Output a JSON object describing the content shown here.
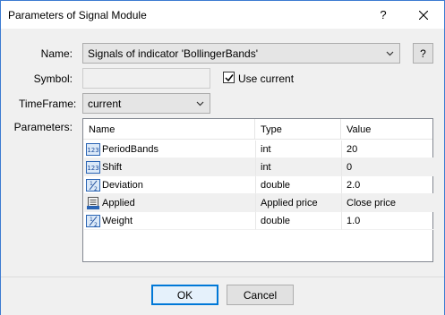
{
  "window": {
    "title": "Parameters of Signal Module",
    "help_label": "?",
    "close_label": "✕"
  },
  "form": {
    "name_label": "Name:",
    "name_value": "Signals of indicator 'BollingerBands'",
    "name_help_label": "?",
    "symbol_label": "Symbol:",
    "symbol_value": "",
    "use_current_label": "Use current",
    "use_current_checked": true,
    "timeframe_label": "TimeFrame:",
    "timeframe_value": "current",
    "parameters_label": "Parameters:"
  },
  "parameters": {
    "columns": [
      "Name",
      "Type",
      "Value"
    ],
    "rows": [
      {
        "name": "PeriodBands",
        "type": "int",
        "value": "20",
        "icon": "int-param-icon"
      },
      {
        "name": "Shift",
        "type": "int",
        "value": "0",
        "icon": "int-param-icon"
      },
      {
        "name": "Deviation",
        "type": "double",
        "value": "2.0",
        "icon": "double-param-icon"
      },
      {
        "name": "Applied",
        "type": "Applied price",
        "value": "Close price",
        "icon": "enum-param-icon"
      },
      {
        "name": "Weight",
        "type": "double",
        "value": "1.0",
        "icon": "double-param-icon"
      }
    ]
  },
  "buttons": {
    "ok_label": "OK",
    "cancel_label": "Cancel"
  }
}
